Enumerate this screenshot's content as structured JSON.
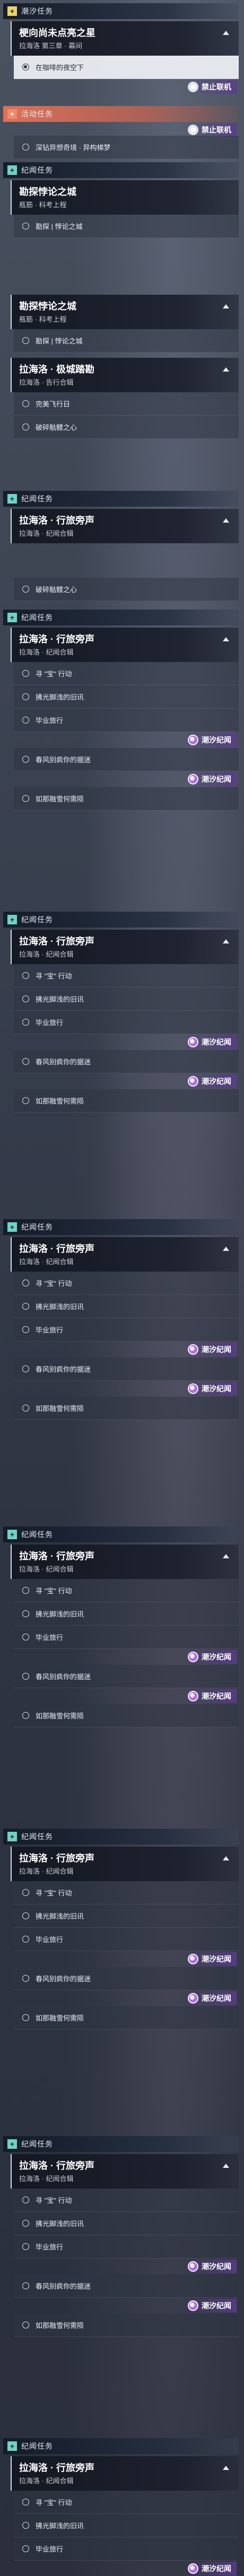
{
  "tide_header": {
    "label": "潮汐任务"
  },
  "activity_header": {
    "label": "活动任务"
  },
  "tide_quest": {
    "title": "梗向尚未点亮之星",
    "subtitle": "拉海洛 第三章 · 幕间",
    "step": "在咖啡的夜空下",
    "badge": "禁止联机"
  },
  "activity_step": {
    "label": "深钻异想奇境 · 异构梯梦",
    "badge": "禁止联机"
  },
  "ji_header": {
    "label": "纪闻任务"
  },
  "explore_quest": {
    "title": "勘探悖论之城",
    "subtitle": "瓶筋 · 科考上程",
    "step": "勘探 | 悖论之城"
  },
  "explore_quest2": {
    "title": "勘探悖论之城",
    "subtitle": "瓶筋 · 科考上程",
    "step": "勘探 | 悖论之城"
  },
  "city_quest": {
    "title": "拉海洛 · 极城踏勘",
    "subtitle": "拉海洛 · 告行合辑",
    "steps": [
      "完美飞行日",
      "破碎骷髅之心"
    ]
  },
  "travel_quest": {
    "title": "拉海洛 · 行旅旁声",
    "subtitle": "拉海洛 · 纪闻合辑",
    "pre_step": "破碎骷髅之心",
    "steps": [
      "寻 \"宝\" 行动",
      "拂光脚浅的旧讯",
      "毕业旅行",
      "春风别疯你的据迷",
      "如那融雪何需陨"
    ],
    "badge": "潮汐纪闻"
  }
}
